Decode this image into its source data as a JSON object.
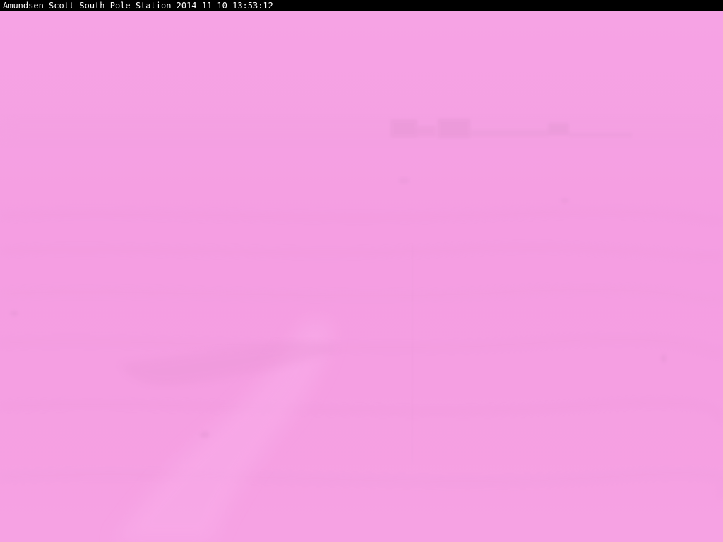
{
  "camera": {
    "caption": "Amundsen-Scott South Pole Station 2014-11-10 13:53:12"
  },
  "scene": {
    "tint_color": "#f5a0e3",
    "shadow_color": "#e993d6",
    "highlight_color": "#f9aeea"
  }
}
